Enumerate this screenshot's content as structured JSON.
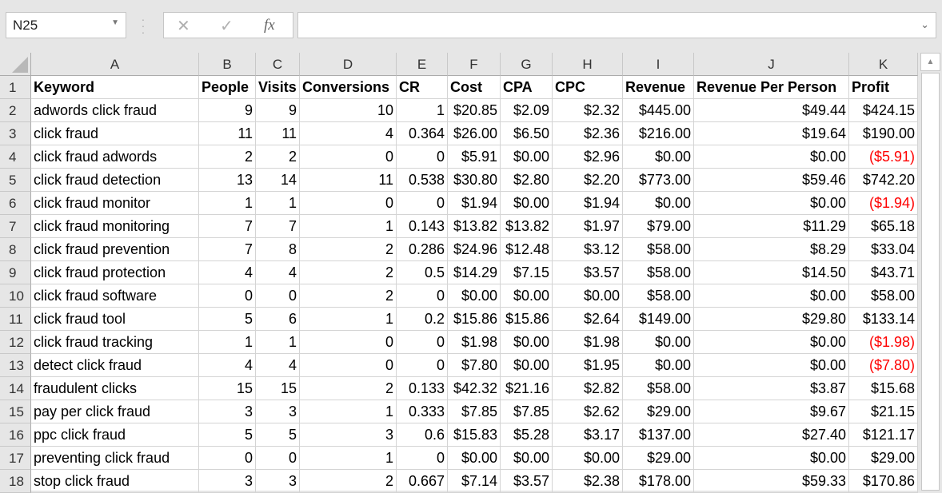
{
  "formula_bar": {
    "name_box": "N25",
    "cancel_icon": "✕",
    "enter_icon": "✓",
    "function_icon": "fx",
    "formula_value": "",
    "expand_icon": "⌄"
  },
  "columns": [
    "A",
    "B",
    "C",
    "D",
    "E",
    "F",
    "G",
    "H",
    "I",
    "J",
    "K"
  ],
  "header_row": [
    "Keyword",
    "People",
    "Visits",
    "Conversions",
    "CR",
    "Cost",
    "CPA",
    "CPC",
    "Revenue",
    "Revenue Per Person",
    "Profit"
  ],
  "rows": [
    {
      "n": "2",
      "cells": [
        "adwords click fraud",
        "9",
        "9",
        "10",
        "1",
        "$20.85",
        "$2.09",
        "$2.32",
        "$445.00",
        "$49.44",
        "$424.15"
      ],
      "neg": false
    },
    {
      "n": "3",
      "cells": [
        "click fraud",
        "11",
        "11",
        "4",
        "0.364",
        "$26.00",
        "$6.50",
        "$2.36",
        "$216.00",
        "$19.64",
        "$190.00"
      ],
      "neg": false
    },
    {
      "n": "4",
      "cells": [
        "click fraud adwords",
        "2",
        "2",
        "0",
        "0",
        "$5.91",
        "$0.00",
        "$2.96",
        "$0.00",
        "$0.00",
        "($5.91)"
      ],
      "neg": true
    },
    {
      "n": "5",
      "cells": [
        "click fraud detection",
        "13",
        "14",
        "11",
        "0.538",
        "$30.80",
        "$2.80",
        "$2.20",
        "$773.00",
        "$59.46",
        "$742.20"
      ],
      "neg": false
    },
    {
      "n": "6",
      "cells": [
        "click fraud monitor",
        "1",
        "1",
        "0",
        "0",
        "$1.94",
        "$0.00",
        "$1.94",
        "$0.00",
        "$0.00",
        "($1.94)"
      ],
      "neg": true
    },
    {
      "n": "7",
      "cells": [
        "click fraud monitoring",
        "7",
        "7",
        "1",
        "0.143",
        "$13.82",
        "$13.82",
        "$1.97",
        "$79.00",
        "$11.29",
        "$65.18"
      ],
      "neg": false
    },
    {
      "n": "8",
      "cells": [
        "click fraud prevention",
        "7",
        "8",
        "2",
        "0.286",
        "$24.96",
        "$12.48",
        "$3.12",
        "$58.00",
        "$8.29",
        "$33.04"
      ],
      "neg": false
    },
    {
      "n": "9",
      "cells": [
        "click fraud protection",
        "4",
        "4",
        "2",
        "0.5",
        "$14.29",
        "$7.15",
        "$3.57",
        "$58.00",
        "$14.50",
        "$43.71"
      ],
      "neg": false
    },
    {
      "n": "10",
      "cells": [
        "click fraud software",
        "0",
        "0",
        "2",
        "0",
        "$0.00",
        "$0.00",
        "$0.00",
        "$58.00",
        "$0.00",
        "$58.00"
      ],
      "neg": false
    },
    {
      "n": "11",
      "cells": [
        "click fraud tool",
        "5",
        "6",
        "1",
        "0.2",
        "$15.86",
        "$15.86",
        "$2.64",
        "$149.00",
        "$29.80",
        "$133.14"
      ],
      "neg": false
    },
    {
      "n": "12",
      "cells": [
        "click fraud tracking",
        "1",
        "1",
        "0",
        "0",
        "$1.98",
        "$0.00",
        "$1.98",
        "$0.00",
        "$0.00",
        "($1.98)"
      ],
      "neg": true
    },
    {
      "n": "13",
      "cells": [
        "detect click fraud",
        "4",
        "4",
        "0",
        "0",
        "$7.80",
        "$0.00",
        "$1.95",
        "$0.00",
        "$0.00",
        "($7.80)"
      ],
      "neg": true
    },
    {
      "n": "14",
      "cells": [
        "fraudulent clicks",
        "15",
        "15",
        "2",
        "0.133",
        "$42.32",
        "$21.16",
        "$2.82",
        "$58.00",
        "$3.87",
        "$15.68"
      ],
      "neg": false
    },
    {
      "n": "15",
      "cells": [
        "pay per click fraud",
        "3",
        "3",
        "1",
        "0.333",
        "$7.85",
        "$7.85",
        "$2.62",
        "$29.00",
        "$9.67",
        "$21.15"
      ],
      "neg": false
    },
    {
      "n": "16",
      "cells": [
        "ppc click fraud",
        "5",
        "5",
        "3",
        "0.6",
        "$15.83",
        "$5.28",
        "$3.17",
        "$137.00",
        "$27.40",
        "$121.17"
      ],
      "neg": false
    },
    {
      "n": "17",
      "cells": [
        "preventing click fraud",
        "0",
        "0",
        "1",
        "0",
        "$0.00",
        "$0.00",
        "$0.00",
        "$29.00",
        "$0.00",
        "$29.00"
      ],
      "neg": false
    },
    {
      "n": "18",
      "cells": [
        "stop click fraud",
        "3",
        "3",
        "2",
        "0.667",
        "$7.14",
        "$3.57",
        "$2.38",
        "$178.00",
        "$59.33",
        "$170.86"
      ],
      "neg": false
    }
  ],
  "colors": {
    "negative": "#ff0000",
    "header_bg": "#e6e6e6",
    "gridline": "#d4d4d4"
  }
}
